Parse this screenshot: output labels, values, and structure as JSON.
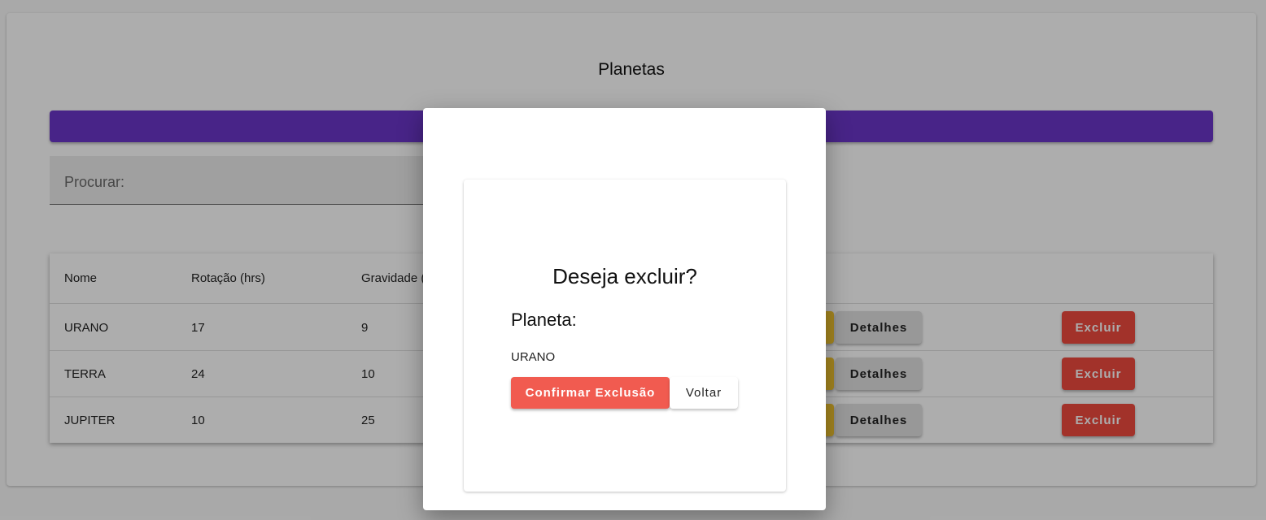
{
  "page": {
    "title": "Planetas"
  },
  "search": {
    "label": "Procurar:"
  },
  "table": {
    "headers": [
      "Nome",
      "Rotação (hrs)",
      "Gravidade ("
    ],
    "rows": [
      {
        "nome": "URANO",
        "rotacao": "17",
        "gravidade": "9"
      },
      {
        "nome": "TERRA",
        "rotacao": "24",
        "gravidade": "10"
      },
      {
        "nome": "JUPITER",
        "rotacao": "10",
        "gravidade": "25"
      }
    ],
    "detalhes_label": "Detalhes",
    "excluir_label": "Excluir"
  },
  "dialog": {
    "title": "Deseja excluir?",
    "label": "Planeta:",
    "value": "URANO",
    "confirm_label": "Confirmar Exclusão",
    "back_label": "Voltar"
  },
  "colors": {
    "primary": "#6a35c9",
    "danger": "#ef4b3f",
    "confirm": "#f15b50",
    "warning": "#f5c730"
  }
}
